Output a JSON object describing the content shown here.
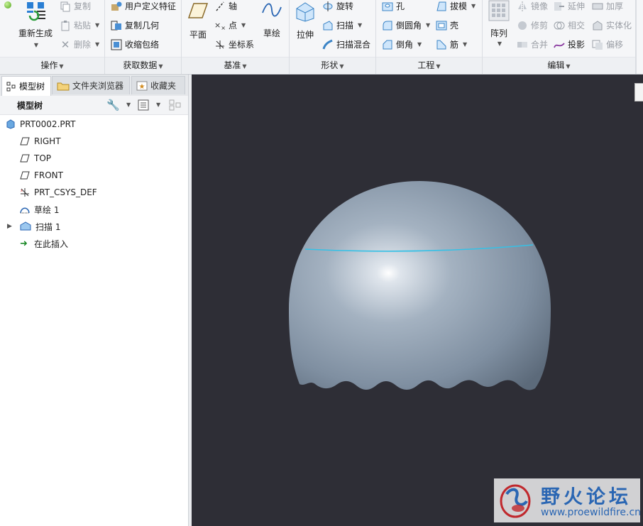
{
  "ribbon": {
    "groups": {
      "operations": "操作",
      "get_data": "获取数据",
      "datum": "基准",
      "shapes": "形状",
      "engineering": "工程",
      "editing": "编辑"
    },
    "operations": {
      "regenerate": "重新生成",
      "copy": "复制",
      "paste": "粘贴",
      "delete": "删除"
    },
    "get_data": {
      "udf": "用户定义特征",
      "copy_geom": "复制几何",
      "shrinkwrap": "收缩包络"
    },
    "datum": {
      "plane": "平面",
      "axis": "轴",
      "point": "点",
      "csys": "坐标系",
      "sketch": "草绘"
    },
    "shapes": {
      "extrude": "拉伸",
      "revolve": "旋转",
      "sweep": "扫描",
      "swept_blend": "扫描混合"
    },
    "engineering": {
      "hole": "孔",
      "round": "倒圆角",
      "chamfer": "倒角",
      "draft": "拔模",
      "shell": "壳",
      "rib": "筋"
    },
    "editing": {
      "pattern": "阵列",
      "mirror": "镜像",
      "trim": "修剪",
      "merge": "合并",
      "extend": "延伸",
      "intersect": "相交",
      "project": "投影",
      "thicken": "加厚",
      "solidify": "实体化",
      "offset": "偏移"
    }
  },
  "tabs": [
    {
      "label": "模型树"
    },
    {
      "label": "文件夹浏览器"
    },
    {
      "label": "收藏夹"
    }
  ],
  "tree": {
    "header": "模型树",
    "items": [
      {
        "label": "PRT0002.PRT",
        "icon": "part-icon"
      },
      {
        "label": "RIGHT",
        "icon": "datum-plane-icon"
      },
      {
        "label": "TOP",
        "icon": "datum-plane-icon"
      },
      {
        "label": "FRONT",
        "icon": "datum-plane-icon"
      },
      {
        "label": "PRT_CSYS_DEF",
        "icon": "csys-icon"
      },
      {
        "label": "草绘 1",
        "icon": "sketch-icon"
      },
      {
        "label": "扫描 1",
        "icon": "sweep-icon"
      },
      {
        "label": "在此插入",
        "icon": "insert-arrow-icon"
      }
    ]
  },
  "watermark": {
    "title": "野火论坛",
    "url": "www.proewildfire.cn"
  },
  "colors": {
    "viewport_bg": "#2e2e36",
    "model": "#8d9cad",
    "edge_highlight": "#35c1e6",
    "watermark_red": "#c0282d",
    "watermark_blue": "#2a66b3"
  }
}
